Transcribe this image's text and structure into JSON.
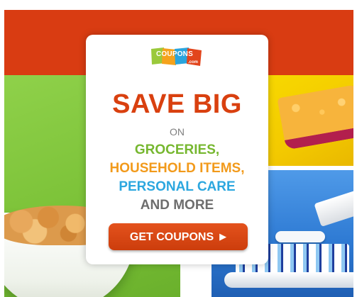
{
  "ad": {
    "brand": {
      "name": "COUPONS",
      "domain": ".com",
      "colors": [
        "#9ac93b",
        "#f5a21c",
        "#2aa4dd",
        "#e2451c"
      ]
    },
    "headline": "SAVE BIG",
    "on_label": "ON",
    "categories": [
      {
        "label": "GROCERIES,",
        "color": "#76b72f"
      },
      {
        "label": "HOUSEHOLD ITEMS,",
        "color": "#f29a1b"
      },
      {
        "label": "PERSONAL CARE",
        "color": "#2ca7df"
      },
      {
        "label": "AND MORE",
        "color": "#6d6d6d"
      }
    ],
    "cta": {
      "label": "GET COUPONS",
      "icon": "play-arrow-icon"
    },
    "colors": {
      "accent": "#d93c12",
      "headline": "#d9400f",
      "button": "#cc3d0c"
    },
    "images": [
      "cereal-bowl",
      "sponge",
      "toothbrush"
    ]
  }
}
